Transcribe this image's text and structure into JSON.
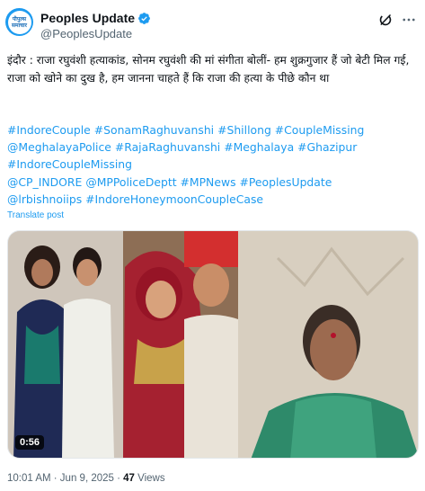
{
  "post": {
    "author_name": "Peoples Update",
    "author_handle": "@PeoplesUpdate",
    "avatar_text_line1": "पीपुल्स",
    "avatar_text_line2": "समाचार",
    "text": "इंदौर : राजा रघुवंशी हत्याकांड, सोनम रघुवंशी की मां संगीता बोलीं- हम शुक्रगुजार हैं जो बेटी मिल गई, राजा को खोने का दुख है, हम जानना चाहते हैं कि राजा की हत्या के पीछे कौन था",
    "hashtags": [
      "#IndoreCouple",
      "#SonamRaghuvanshi",
      "#Shillong",
      "#CoupleMissing",
      "@MeghalayaPolice",
      "#RajaRaghuvanshi",
      "#Meghalaya",
      "#Ghazipur",
      "#IndoreCoupleMissing",
      "@CP_INDORE",
      "@MPPoliceDeptt",
      "#MPNews",
      "#PeoplesUpdate",
      "@lrbishnoiips",
      "#IndoreHoneymoonCoupleCase"
    ],
    "translate_label": "Translate post",
    "video_duration": "0:56",
    "timestamp": "10:01 AM · Jun 9, 2025 · ",
    "views_count": "47",
    "views_label": " Views"
  },
  "icons": {
    "verified": "verified-badge-icon",
    "grok": "grok-icon",
    "more": "more-options-icon"
  },
  "colors": {
    "accent": "#1d9bf0",
    "text": "#0f1419",
    "secondary": "#536471"
  }
}
